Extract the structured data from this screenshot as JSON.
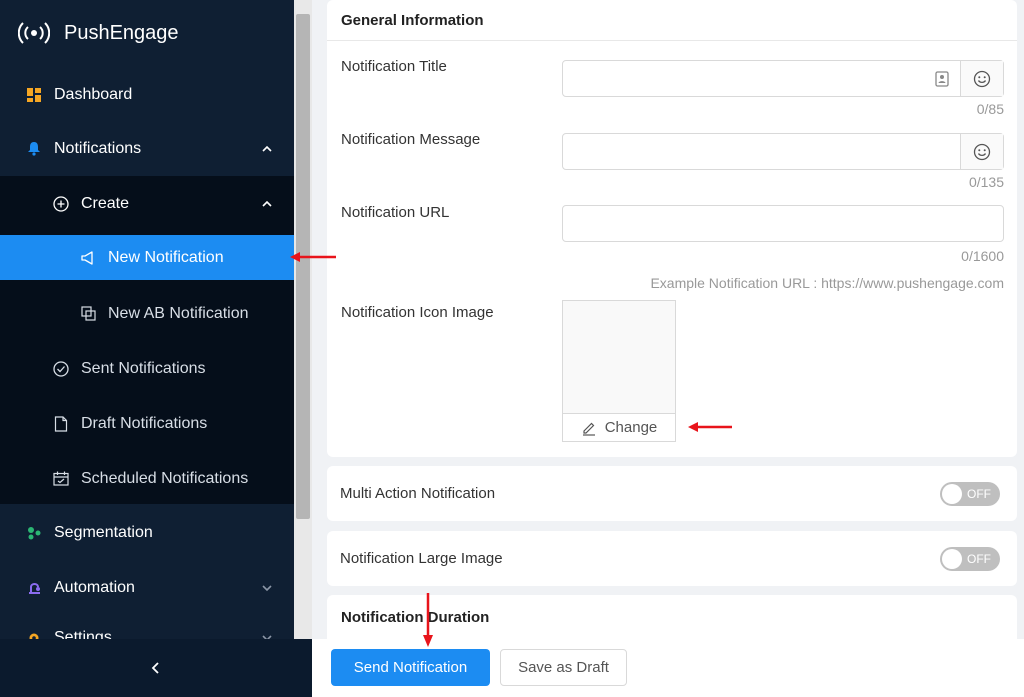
{
  "sidebar": {
    "brand": "PushEngage",
    "items": {
      "dashboard": "Dashboard",
      "notifications": "Notifications",
      "create": "Create",
      "new_notification": "New Notification",
      "new_ab_notification": "New AB Notification",
      "sent_notifications": "Sent Notifications",
      "draft_notifications": "Draft Notifications",
      "scheduled_notifications": "Scheduled Notifications",
      "segmentation": "Segmentation",
      "automation": "Automation",
      "settings": "Settings"
    },
    "collapse_icon": "chevron-left-icon"
  },
  "general": {
    "title": "General Information",
    "notification_title_label": "Notification Title",
    "notification_title_counter": "0/85",
    "notification_message_label": "Notification Message",
    "notification_message_counter": "0/135",
    "notification_url_label": "Notification URL",
    "notification_url_counter": "0/1600",
    "notification_url_example": "Example Notification URL : https://www.pushengage.com",
    "icon_image_label": "Notification Icon Image",
    "change_label": "Change"
  },
  "multi_action": {
    "label": "Multi Action Notification",
    "toggle": "OFF"
  },
  "large_image": {
    "label": "Notification Large Image",
    "toggle": "OFF"
  },
  "duration": {
    "title": "Notification Duration"
  },
  "footer": {
    "send_label": "Send Notification",
    "draft_label": "Save as Draft"
  },
  "colors": {
    "accent": "#1c8cf2",
    "sidebar": "#0f1f33",
    "annotation": "#e8141b"
  }
}
